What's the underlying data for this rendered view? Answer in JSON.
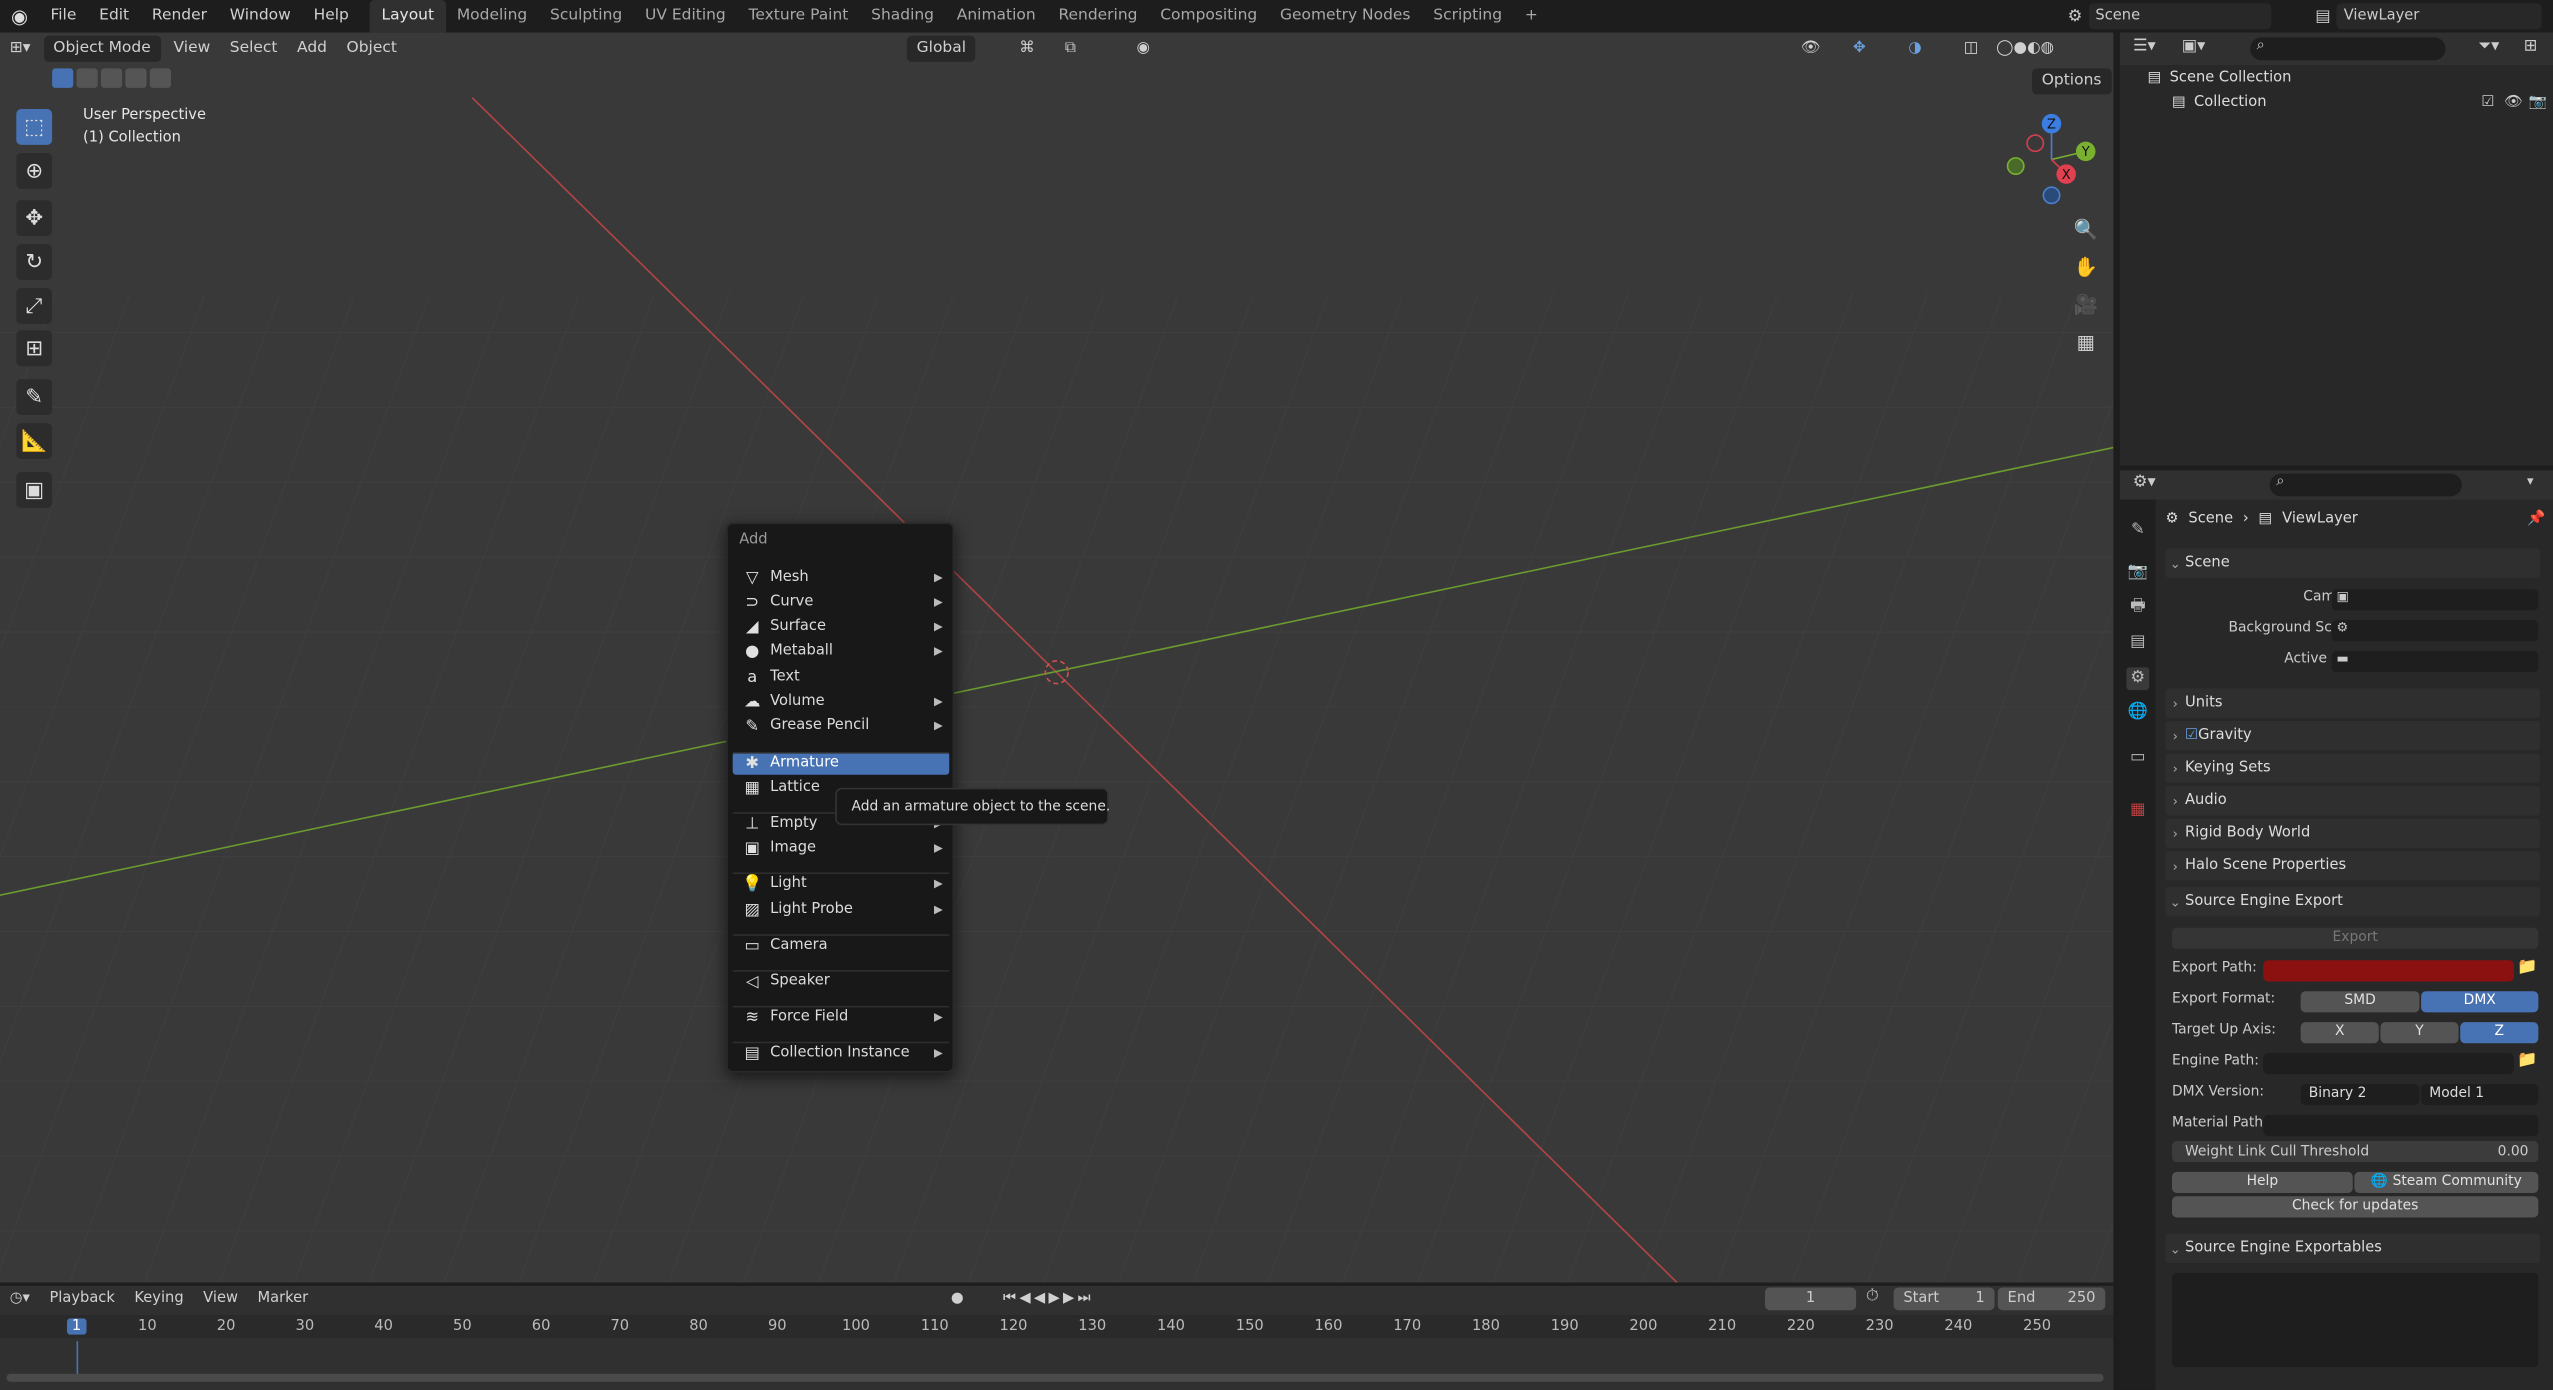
{
  "topbar": {
    "menus": [
      "File",
      "Edit",
      "Render",
      "Window",
      "Help"
    ],
    "workspaces": [
      "Layout",
      "Modeling",
      "Sculpting",
      "UV Editing",
      "Texture Paint",
      "Shading",
      "Animation",
      "Rendering",
      "Compositing",
      "Geometry Nodes",
      "Scripting"
    ],
    "active_workspace": "Layout",
    "add_tab": "+",
    "scene": "Scene",
    "view_layer": "ViewLayer"
  },
  "viewport": {
    "mode": "Object Mode",
    "menus": [
      "View",
      "Select",
      "Add",
      "Object"
    ],
    "orientation": "Global",
    "options": "Options",
    "info_line1": "User Perspective",
    "info_line2": "(1) Collection",
    "gizmo_axes": {
      "x": "X",
      "y": "Y",
      "z": "Z"
    }
  },
  "add_menu": {
    "title": "Add",
    "items": [
      {
        "label": "Mesh",
        "icon": "mesh-icon",
        "sub": true
      },
      {
        "label": "Curve",
        "icon": "curve-icon",
        "sub": true
      },
      {
        "label": "Surface",
        "icon": "surface-icon",
        "sub": true
      },
      {
        "label": "Metaball",
        "icon": "metaball-icon",
        "sub": true
      },
      {
        "label": "Text",
        "icon": "text-icon",
        "sub": false
      },
      {
        "label": "Volume",
        "icon": "volume-icon",
        "sub": true
      },
      {
        "label": "Grease Pencil",
        "icon": "grease-pencil-icon",
        "sub": true
      },
      {
        "label": "Armature",
        "icon": "armature-icon",
        "sub": false,
        "highlighted": true
      },
      {
        "label": "Lattice",
        "icon": "lattice-icon",
        "sub": false
      },
      {
        "label": "Empty",
        "icon": "empty-icon",
        "sub": true
      },
      {
        "label": "Image",
        "icon": "image-icon",
        "sub": true
      },
      {
        "label": "Light",
        "icon": "light-icon",
        "sub": true
      },
      {
        "label": "Light Probe",
        "icon": "light-probe-icon",
        "sub": true
      },
      {
        "label": "Camera",
        "icon": "camera-icon",
        "sub": false
      },
      {
        "label": "Speaker",
        "icon": "speaker-icon",
        "sub": false
      },
      {
        "label": "Force Field",
        "icon": "force-field-icon",
        "sub": true
      },
      {
        "label": "Collection Instance",
        "icon": "collection-instance-icon",
        "sub": true
      }
    ],
    "tooltip": "Add an armature object to the scene."
  },
  "outliner": {
    "root": "Scene Collection",
    "collection": "Collection"
  },
  "properties": {
    "breadcrumb": [
      "Scene",
      "ViewLayer"
    ],
    "scene_panel": {
      "title": "Scene",
      "camera_label": "Camera",
      "background_label": "Background Scene",
      "active_clip_label": "Active Clip"
    },
    "collapsed_panels": [
      "Units",
      "Gravity",
      "Keying Sets",
      "Audio",
      "Rigid Body World",
      "Halo Scene Properties"
    ],
    "gravity_checked": true,
    "source_export": {
      "title": "Source Engine Export",
      "export_button": "Export",
      "export_path_label": "Export Path:",
      "export_format_label": "Export Format:",
      "formats": [
        "SMD",
        "DMX"
      ],
      "selected_format": "DMX",
      "up_axis_label": "Target Up Axis:",
      "axes": [
        "X",
        "Y",
        "Z"
      ],
      "selected_axis": "Z",
      "engine_path_label": "Engine Path:",
      "dmx_version_label": "DMX Version:",
      "dmx_binary": "Binary 2",
      "dmx_model": "Model 1",
      "material_path_label": "Material Path:",
      "weight_label": "Weight Link Cull Threshold",
      "weight_value": "0.00",
      "help": "Help",
      "steam": "Steam Community",
      "updates": "Check for updates"
    },
    "exportables_title": "Source Engine Exportables"
  },
  "timeline": {
    "menus": [
      "Playback",
      "Keying",
      "View",
      "Marker"
    ],
    "current_frame": "1",
    "start_label": "Start",
    "start": "1",
    "end_label": "End",
    "end": "250",
    "ticks": [
      "1",
      "10",
      "20",
      "30",
      "40",
      "50",
      "60",
      "70",
      "80",
      "90",
      "100",
      "110",
      "120",
      "130",
      "140",
      "150",
      "160",
      "170",
      "180",
      "190",
      "200",
      "210",
      "220",
      "230",
      "240",
      "250"
    ]
  },
  "colors": {
    "accent": "#4772b3",
    "x_axis": "#b04545",
    "y_axis": "#6a9a30",
    "error_field": "#8b1010"
  }
}
